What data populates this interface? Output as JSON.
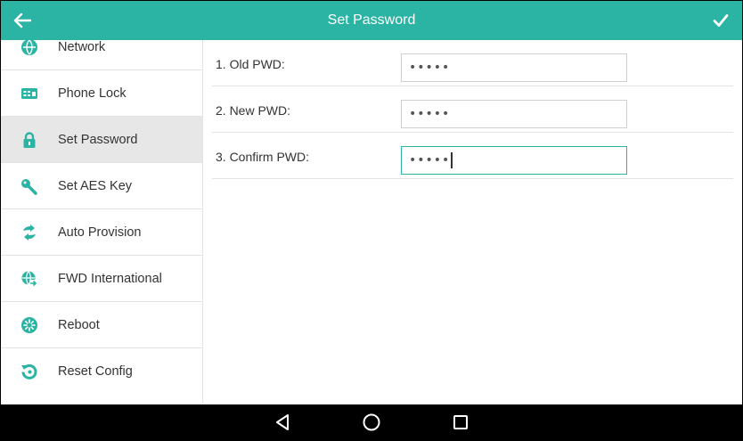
{
  "header": {
    "title": "Set Password",
    "accent_color": "#2bb3a3"
  },
  "sidebar": {
    "items": [
      {
        "label": "Network",
        "icon": "network-icon"
      },
      {
        "label": "Phone Lock",
        "icon": "phone-lock-icon"
      },
      {
        "label": "Set Password",
        "icon": "lock-icon",
        "active": true
      },
      {
        "label": "Set AES Key",
        "icon": "key-icon"
      },
      {
        "label": "Auto Provision",
        "icon": "sync-icon"
      },
      {
        "label": "FWD International",
        "icon": "globe-forward-icon"
      },
      {
        "label": "Reboot",
        "icon": "reboot-icon"
      },
      {
        "label": "Reset Config",
        "icon": "reset-icon"
      }
    ]
  },
  "form": {
    "rows": [
      {
        "label": "1. Old PWD:",
        "value": "•••••"
      },
      {
        "label": "2. New PWD:",
        "value": "•••••"
      },
      {
        "label": "3. Confirm PWD:",
        "value": "•••••",
        "focused": true
      }
    ]
  },
  "navbar": {
    "buttons": [
      "back-triangle-icon",
      "home-circle-icon",
      "recents-square-icon"
    ]
  }
}
